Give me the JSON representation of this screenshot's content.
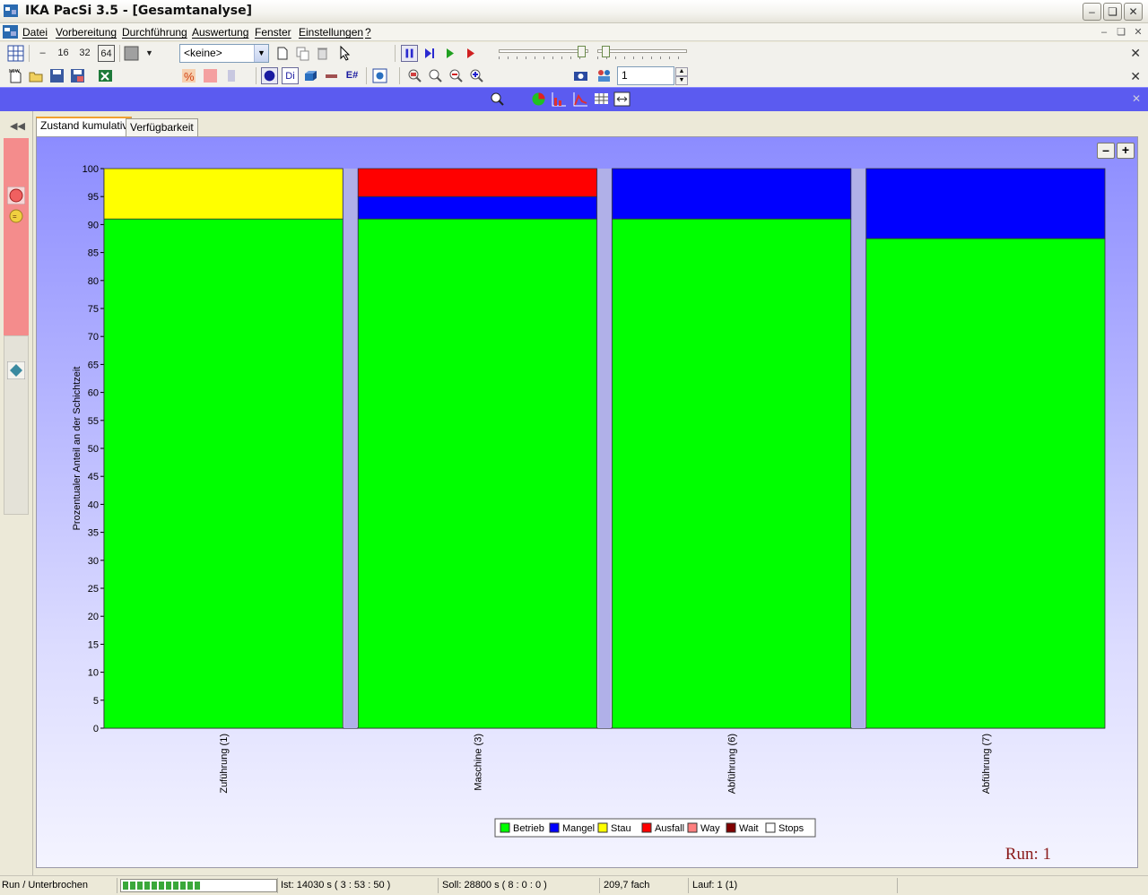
{
  "window": {
    "title": "IKA PacSi 3.5 - [Gesamtanalyse]"
  },
  "menu": [
    "Datei",
    "Vorbereitung",
    "Durchführung",
    "Auswertung",
    "Fenster",
    "Einstellungen",
    "?"
  ],
  "toolbar1": {
    "grid_sizes": [
      "16",
      "32",
      "64"
    ],
    "combo_value": "<keine>"
  },
  "toolbar2": {
    "di_label": "Di",
    "ef_label": "E#",
    "spin_value": "1"
  },
  "tabs": [
    {
      "label": "Zustand kumulativ",
      "active": true
    },
    {
      "label": "Verfügbarkeit",
      "active": false
    }
  ],
  "chart_data": {
    "type": "bar",
    "stacked": true,
    "ylabel": "Prozentualer Anteil an der Schichtzeit",
    "ylim": [
      0,
      100
    ],
    "ytick_step": 5,
    "categories": [
      "Zuführung (1)",
      "Maschine (3)",
      "Abführung (6)",
      "Abführung (7)"
    ],
    "series": [
      {
        "name": "Betrieb",
        "color": "#00ff00",
        "values": [
          91,
          91,
          91,
          87.5
        ]
      },
      {
        "name": "Mangel",
        "color": "#0000ff",
        "values": [
          0,
          4,
          9,
          12.5
        ]
      },
      {
        "name": "Stau",
        "color": "#ffff00",
        "values": [
          9,
          0,
          0,
          0
        ]
      },
      {
        "name": "Ausfall",
        "color": "#ff0000",
        "values": [
          0,
          5,
          0,
          0
        ]
      },
      {
        "name": "Way",
        "color": "#ff8080",
        "values": [
          0,
          0,
          0,
          0
        ]
      },
      {
        "name": "Wait",
        "color": "#800000",
        "values": [
          0,
          0,
          0,
          0
        ]
      },
      {
        "name": "Stops",
        "color": "#ffffff",
        "values": [
          0,
          0,
          0,
          0
        ]
      }
    ],
    "legend_position": "bottom-center",
    "run_label": "Run: 1"
  },
  "status": {
    "state": "Run / Unterbrochen",
    "progress": 0.52,
    "ist": "Ist: 14030  s   ( 3 : 53 : 50 )",
    "soll": "Soll: 28800  s   ( 8 : 0 : 0 )",
    "throughput": "209,7 fach",
    "lauf": "Lauf: 1 (1)"
  }
}
